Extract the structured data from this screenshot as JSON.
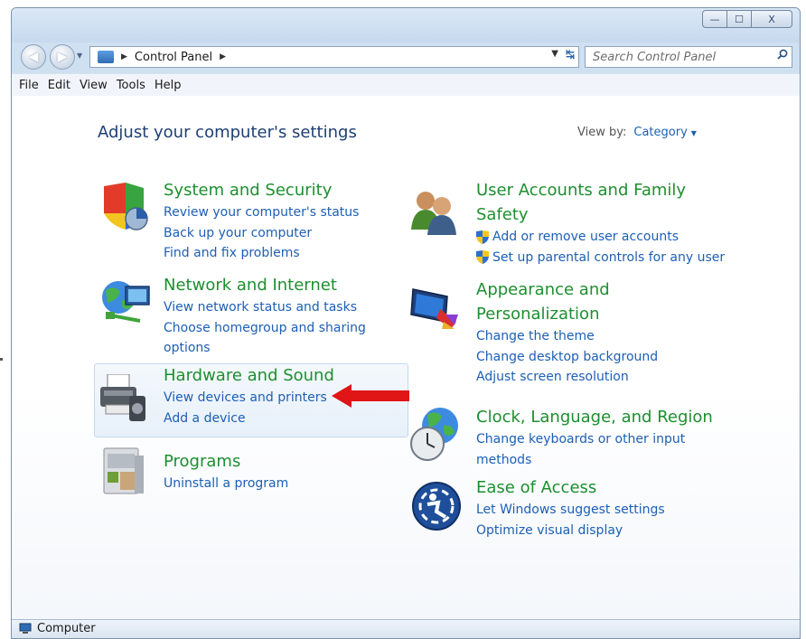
{
  "window": {
    "controls": {
      "minimize": "—",
      "maximize": "☐",
      "close": "X"
    }
  },
  "address_bar": {
    "breadcrumb": "Control Panel",
    "search_placeholder": "Search Control Panel"
  },
  "menu": [
    "File",
    "Edit",
    "View",
    "Tools",
    "Help"
  ],
  "main": {
    "heading": "Adjust your computer's settings",
    "view_by_label": "View by:",
    "view_by_value": "Category"
  },
  "categories": [
    {
      "title": "System and Security",
      "links": [
        "Review your computer's status",
        "Back up your computer",
        "Find and fix problems"
      ]
    },
    {
      "title": "Network and Internet",
      "links": [
        "View network status and tasks",
        "Choose homegroup and sharing",
        "options"
      ]
    },
    {
      "title": "Hardware and Sound",
      "links": [
        "View devices and printers",
        "Add a device"
      ]
    },
    {
      "title": "Programs",
      "links": [
        "Uninstall a program"
      ]
    },
    {
      "title_lines": [
        "User Accounts and Family",
        "Safety"
      ],
      "links": [
        "Add or remove user accounts",
        "Set up parental controls for any user"
      ]
    },
    {
      "title_lines": [
        "Appearance and",
        "Personalization"
      ],
      "links": [
        "Change the theme",
        "Change desktop background",
        "Adjust screen resolution"
      ]
    },
    {
      "title": "Clock, Language, and Region",
      "links": [
        "Change keyboards or other input",
        "methods"
      ]
    },
    {
      "title": "Ease of Access",
      "links": [
        "Let Windows suggest settings",
        "Optimize visual display"
      ]
    }
  ],
  "status_bar": {
    "text": "Computer"
  },
  "colors": {
    "category_title": "#1d8f2f",
    "link": "#1d5fb4",
    "heading": "#1e3f73",
    "highlight_arrow": "#e01515"
  }
}
